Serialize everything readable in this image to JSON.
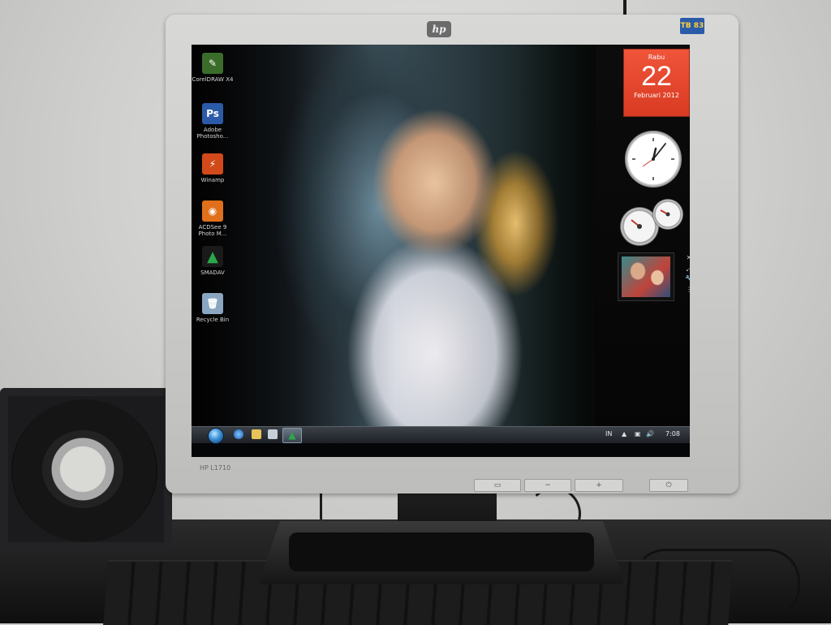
{
  "monitor": {
    "brand_logo": "hp",
    "energy_badge": "TB 83",
    "model": "HP L1710"
  },
  "desktop_icons": [
    {
      "label": "CorelDRAW X4",
      "icon": "coreldraw-icon",
      "color": "#3b6d2a"
    },
    {
      "label": "Adobe Photosho...",
      "icon": "photoshop-icon",
      "color": "#2b5aa8"
    },
    {
      "label": "Winamp",
      "icon": "winamp-icon",
      "color": "#d24a1a"
    },
    {
      "label": "ACDSee 9 Photo M...",
      "icon": "acdsee-icon",
      "color": "#e0701c"
    },
    {
      "label": "SMADAV",
      "icon": "smadav-icon",
      "color": "#2aa84a"
    },
    {
      "label": "Recycle Bin",
      "icon": "recycle-bin-icon",
      "color": "#8aa6c0"
    }
  ],
  "calendar_gadget": {
    "day_name": "Rabu",
    "day_number": "22",
    "month_year": "Februari 2012",
    "color": "#e84a2e"
  },
  "taskbar": {
    "language": "IN",
    "time": "7:08"
  }
}
